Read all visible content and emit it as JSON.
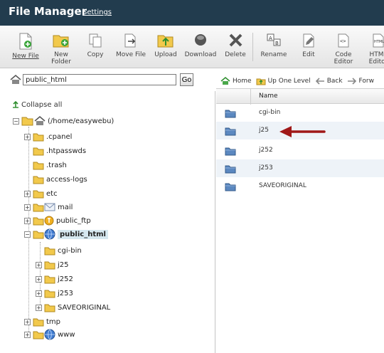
{
  "header": {
    "title": "File Manager",
    "settings_link": "Settings"
  },
  "toolbar": {
    "buttons": [
      {
        "id": "new-file",
        "line1": "New File",
        "line2": "",
        "icon": "new-file-icon"
      },
      {
        "id": "new-folder",
        "line1": "New",
        "line2": "Folder",
        "icon": "new-folder-icon"
      },
      {
        "id": "copy",
        "line1": "Copy",
        "line2": "",
        "icon": "copy-icon"
      },
      {
        "id": "move-file",
        "line1": "Move File",
        "line2": "",
        "icon": "move-file-icon"
      },
      {
        "id": "upload",
        "line1": "Upload",
        "line2": "",
        "icon": "upload-icon"
      },
      {
        "id": "download",
        "line1": "Download",
        "line2": "",
        "icon": "download-icon"
      },
      {
        "id": "delete",
        "line1": "Delete",
        "line2": "",
        "icon": "delete-icon"
      },
      {
        "id": "rename",
        "line1": "Rename",
        "line2": "",
        "icon": "rename-icon"
      },
      {
        "id": "edit",
        "line1": "Edit",
        "line2": "",
        "icon": "edit-icon"
      },
      {
        "id": "code-editor",
        "line1": "Code",
        "line2": "Editor",
        "icon": "code-editor-icon"
      },
      {
        "id": "html-editor",
        "line1": "HTML",
        "line2": "Editor",
        "icon": "html-editor-icon"
      }
    ]
  },
  "path_bar": {
    "value": "public_html",
    "go_label": "Go"
  },
  "tree": {
    "collapse_label": "Collapse all",
    "root_label": "(/home/easywebu)",
    "items": [
      {
        "label": ".cpanel",
        "expandable": true
      },
      {
        "label": ".htpasswds",
        "expandable": false
      },
      {
        "label": ".trash",
        "expandable": false
      },
      {
        "label": "access-logs",
        "expandable": false
      },
      {
        "label": "etc",
        "expandable": true
      },
      {
        "label": "mail",
        "expandable": true
      },
      {
        "label": "public_ftp",
        "expandable": true
      },
      {
        "label": "public_html",
        "expandable": true,
        "selected": true
      },
      {
        "label": "cgi-bin",
        "expandable": false
      },
      {
        "label": "j25",
        "expandable": true
      },
      {
        "label": "j252",
        "expandable": true
      },
      {
        "label": "j253",
        "expandable": true
      },
      {
        "label": "SAVEORIGINAL",
        "expandable": true
      },
      {
        "label": "tmp",
        "expandable": true
      },
      {
        "label": "www",
        "expandable": true
      }
    ]
  },
  "right_toolbar": {
    "home": "Home",
    "up_one_level": "Up One Level",
    "back": "Back",
    "forward": "Forw"
  },
  "list": {
    "column_name": "Name",
    "rows": [
      {
        "name": "cgi-bin"
      },
      {
        "name": "j25"
      },
      {
        "name": "j252"
      },
      {
        "name": "j253"
      },
      {
        "name": "SAVEORIGINAL"
      }
    ]
  },
  "colors": {
    "header_bg": "#223c4e",
    "selected_bg": "#d6e8f0",
    "folder_blue": "#4a78b0",
    "arrow_red": "#a01818"
  }
}
